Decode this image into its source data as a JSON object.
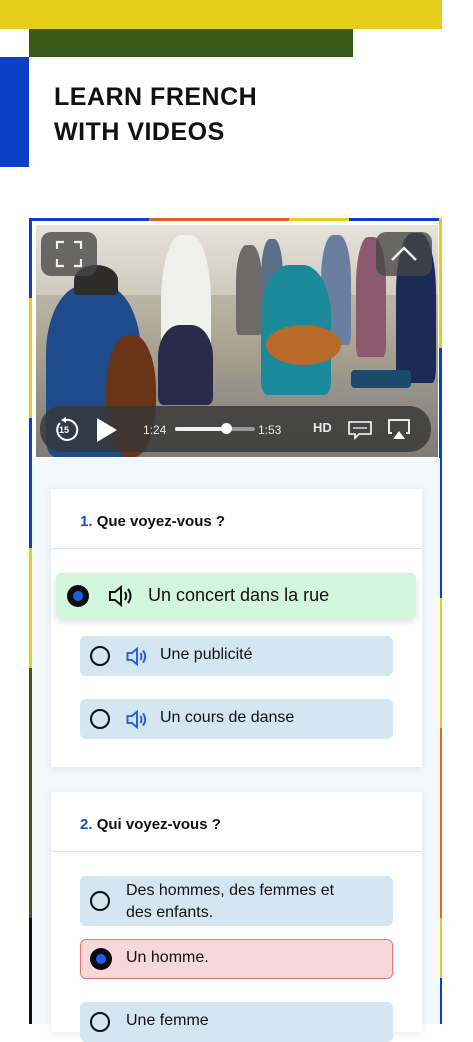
{
  "header": {
    "title_line1": "LEARN FRENCH",
    "title_line2": "WITH VIDEOS"
  },
  "colors": {
    "yellow": "#e6cf1a",
    "green": "#3a5a1a",
    "blue": "#0a3fc8",
    "accent": "#1450c8",
    "correct": "#d3f5dc",
    "wrong": "#f8d7db",
    "option": "#d4e6f2"
  },
  "video": {
    "elapsed": "1:24",
    "remaining": "1:53",
    "quality": "HD",
    "progress": 0.65,
    "icons": [
      "fullscreen-icon",
      "collapse-chevron-icon",
      "rewind-15-icon",
      "play-icon",
      "subtitles-icon",
      "airplay-icon"
    ],
    "rewind_label": "15"
  },
  "questions": [
    {
      "number": "1.",
      "text": "Que voyez-vous ?",
      "options": [
        {
          "label": "Un concert dans la rue",
          "state": "selected-correct"
        },
        {
          "label": "Une publicité",
          "state": "unselected"
        },
        {
          "label": "Un cours de danse",
          "state": "unselected"
        }
      ]
    },
    {
      "number": "2.",
      "text": "Qui voyez-vous ?",
      "options": [
        {
          "label_line1": "Des hommes, des femmes et",
          "label_line2": "des enfants.",
          "state": "unselected"
        },
        {
          "label": "Un homme.",
          "state": "selected-wrong"
        },
        {
          "label": "Une femme",
          "state": "unselected"
        }
      ]
    }
  ]
}
